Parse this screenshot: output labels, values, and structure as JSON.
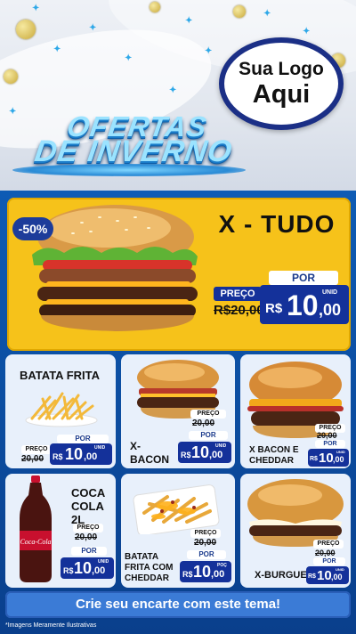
{
  "header": {
    "logo_line1": "Sua Logo",
    "logo_line2": "Aqui",
    "title_line1": "OFERTAS",
    "title_line2": "DE INVERNO"
  },
  "hero": {
    "discount": "-50%",
    "name": "X - TUDO",
    "preco_label": "PREÇO",
    "old_price": "R$20,00",
    "por_label": "POR",
    "currency": "R$",
    "price_int": "10",
    "price_dec": ",00",
    "unit": "UNID"
  },
  "products": [
    {
      "name": "BATATA FRITA",
      "preco_label": "PREÇO",
      "old_price": "20,00",
      "por_label": "POR",
      "currency": "R$",
      "price_int": "10",
      "price_dec": ",00",
      "unit": "UNID"
    },
    {
      "name": "X-\nBACON",
      "preco_label": "PREÇO",
      "old_price": "20,00",
      "por_label": "POR",
      "currency": "R$",
      "price_int": "10",
      "price_dec": ",00",
      "unit": "UNID"
    },
    {
      "name": "X BACON E CHEDDAR",
      "preco_label": "PREÇO",
      "old_price": "20,00",
      "por_label": "POR",
      "currency": "R$",
      "price_int": "10",
      "price_dec": ",00",
      "unit": "UNID"
    },
    {
      "name": "COCA COLA 2L",
      "preco_label": "PREÇO",
      "old_price": "20,00",
      "por_label": "POR",
      "currency": "R$",
      "price_int": "10",
      "price_dec": ",00",
      "unit": "UNID"
    },
    {
      "name": "BATATA FRITA COM CHEDDAR",
      "preco_label": "PREÇO",
      "old_price": "20,00",
      "por_label": "POR",
      "currency": "R$",
      "price_int": "10",
      "price_dec": ",00",
      "unit": "POÇ"
    },
    {
      "name": "X-BURGUER",
      "preco_label": "PREÇO",
      "old_price": "20,00",
      "por_label": "POR",
      "currency": "R$",
      "price_int": "10",
      "price_dec": ",00",
      "unit": "UNID"
    }
  ],
  "footer": {
    "cta": "Crie seu encarte com este tema!",
    "disclaimer": "*Imagens Meramente Ilustrativas"
  },
  "colors": {
    "brand_blue": "#14319a",
    "hero_yellow": "#f6c21a",
    "background_blue": "#0b4fa0"
  }
}
